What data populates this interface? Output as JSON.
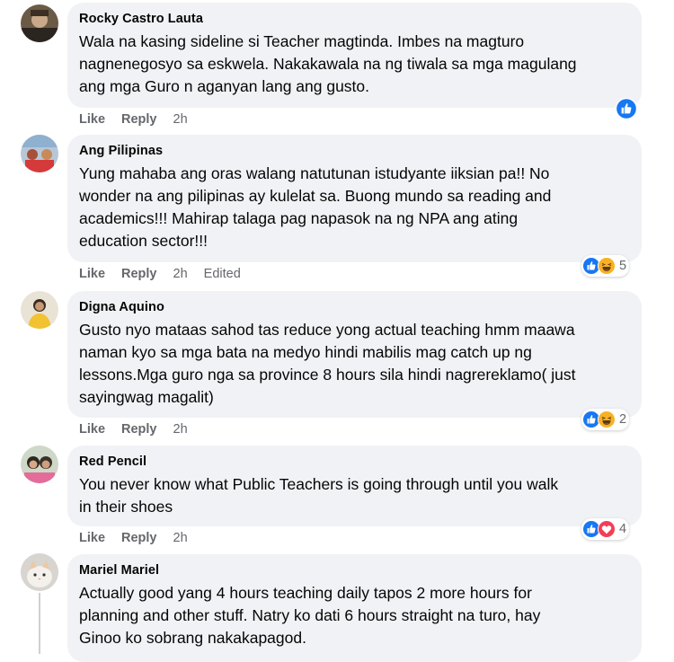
{
  "comments": [
    {
      "author": "Rocky Castro Lauta",
      "text": "Wala na kasing sideline si Teacher magtinda. Imbes na magturo\nnagnenegosyo sa eskwela. Nakakawala na ng tiwala sa mga magulang\nang mga Guro n aganyan lang ang gusto.",
      "like": "Like",
      "reply": "Reply",
      "time": "2h",
      "reactions": [
        "like"
      ],
      "reaction_count": ""
    },
    {
      "author": "Ang Pilipinas",
      "text": "Yung mahaba ang oras walang natutunan istudyante iiksian pa!! No\nwonder na ang pilipinas ay kulelat sa. Buong mundo sa reading and\nacademics!!! Mahirap talaga pag napasok na ng NPA ang ating\neducation sector!!!",
      "like": "Like",
      "reply": "Reply",
      "time": "2h",
      "edited": "Edited",
      "reactions": [
        "like",
        "haha"
      ],
      "reaction_count": "5"
    },
    {
      "author": "Digna Aquino",
      "text": "Gusto nyo mataas sahod tas reduce yong actual teaching hmm maawa\nnaman kyo sa mga bata na medyo hindi mabilis mag catch up ng\nlessons.Mga guro nga sa province 8 hours sila hindi nagrereklamo( just\nsayingwag magalit)",
      "like": "Like",
      "reply": "Reply",
      "time": "2h",
      "reactions": [
        "like",
        "haha"
      ],
      "reaction_count": "2"
    },
    {
      "author": "Red Pencil",
      "text": "You never know what Public Teachers is going through until you walk\nin their shoes",
      "like": "Like",
      "reply": "Reply",
      "time": "2h",
      "reactions": [
        "like",
        "love"
      ],
      "reaction_count": "4"
    },
    {
      "author": "Mariel Mariel",
      "text": "Actually good yang 4 hours teaching daily tapos 2 more hours for\nplanning and other stuff. Natry ko dati 6 hours straight na turo, hay\nGinoo ko sobrang nakakapagod."
    }
  ],
  "colors": {
    "bubble": "#f0f2f5",
    "meta_text": "#65676b",
    "like_blue": "#1877f2",
    "love_red": "#f33e58",
    "haha_yellow": "#f7b125"
  }
}
